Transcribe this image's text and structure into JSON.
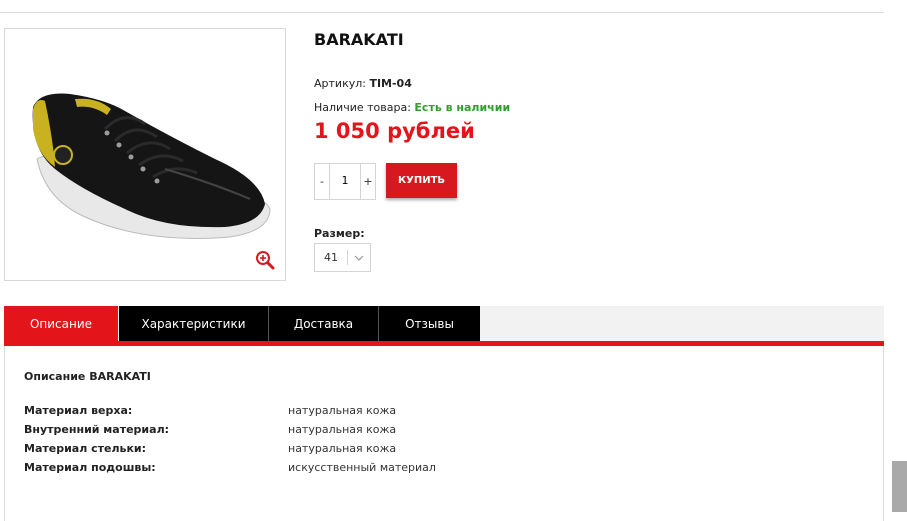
{
  "product": {
    "title": "BARAKATI",
    "sku_label": "Артикул: ",
    "sku_value": "TIM-04",
    "stock_label": "Наличие товара: ",
    "stock_value": "Есть в наличии",
    "price": "1 050 рублей",
    "quantity": "1",
    "qty_minus": "-",
    "qty_plus": "+",
    "buy_label": "КУПИТЬ",
    "size_label": "Размер:",
    "size_value": "41",
    "image_icon": "zoom-icon"
  },
  "tabs": [
    {
      "label": "Описание",
      "active": true
    },
    {
      "label": "Характеристики",
      "active": false
    },
    {
      "label": "Доставка",
      "active": false
    },
    {
      "label": "Отзывы",
      "active": false
    }
  ],
  "description": {
    "title": "Описание BARAKATI",
    "specs": [
      {
        "label": "Материал верха:",
        "value": "натуральная кожа"
      },
      {
        "label": "Внутренний материал:",
        "value": "натуральная кожа"
      },
      {
        "label": "Материал стельки:",
        "value": "натуральная кожа"
      },
      {
        "label": "Материал подошвы:",
        "value": "искусственный материал"
      }
    ]
  },
  "colors": {
    "accent": "#e4141b",
    "tab_bg": "#000000",
    "stock": "#2f9e2f"
  }
}
